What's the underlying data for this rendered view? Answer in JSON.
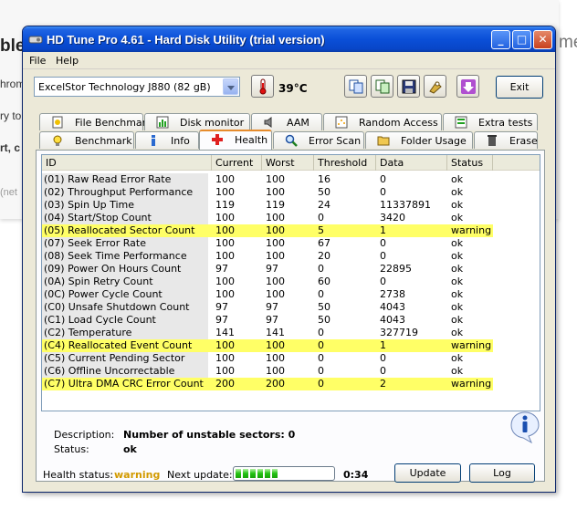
{
  "background_page": {
    "fragments": [
      "ble",
      "hrom",
      "ry to",
      "rt, c",
      "(net",
      "me"
    ]
  },
  "window": {
    "title": "HD Tune Pro 4.61 - Hard Disk Utility (trial version)",
    "minimize_glyph": "_",
    "maximize_glyph": "□",
    "close_glyph": "✕"
  },
  "menu": {
    "file": "File",
    "help": "Help"
  },
  "toolbar": {
    "drive": "ExcelStor Technology J880 (82 gB)",
    "temperature": "39°C",
    "exit_label": "Exit",
    "icons": [
      "copy-icon",
      "copy-alt-icon",
      "save-icon",
      "options-icon",
      "download-icon"
    ]
  },
  "tabs": {
    "top_row": [
      "File Benchmark",
      "Disk monitor",
      "AAM",
      "Random Access",
      "Extra tests"
    ],
    "bottom_row": [
      "Benchmark",
      "Info",
      "Health",
      "Error Scan",
      "Folder Usage",
      "Erase"
    ],
    "active": "Health"
  },
  "table": {
    "columns": [
      "ID",
      "Current",
      "Worst",
      "Threshold",
      "Data",
      "Status"
    ],
    "rows": [
      {
        "id": "(01) Raw Read Error Rate",
        "current": "100",
        "worst": "100",
        "threshold": "16",
        "data": "0",
        "status": "ok",
        "warn": false
      },
      {
        "id": "(02) Throughput Performance",
        "current": "100",
        "worst": "100",
        "threshold": "50",
        "data": "0",
        "status": "ok",
        "warn": false
      },
      {
        "id": "(03) Spin Up Time",
        "current": "119",
        "worst": "119",
        "threshold": "24",
        "data": "11337891",
        "status": "ok",
        "warn": false
      },
      {
        "id": "(04) Start/Stop Count",
        "current": "100",
        "worst": "100",
        "threshold": "0",
        "data": "3420",
        "status": "ok",
        "warn": false
      },
      {
        "id": "(05) Reallocated Sector Count",
        "current": "100",
        "worst": "100",
        "threshold": "5",
        "data": "1",
        "status": "warning",
        "warn": true
      },
      {
        "id": "(07) Seek Error Rate",
        "current": "100",
        "worst": "100",
        "threshold": "67",
        "data": "0",
        "status": "ok",
        "warn": false
      },
      {
        "id": "(08) Seek Time Performance",
        "current": "100",
        "worst": "100",
        "threshold": "20",
        "data": "0",
        "status": "ok",
        "warn": false
      },
      {
        "id": "(09) Power On Hours Count",
        "current": "97",
        "worst": "97",
        "threshold": "0",
        "data": "22895",
        "status": "ok",
        "warn": false
      },
      {
        "id": "(0A) Spin Retry Count",
        "current": "100",
        "worst": "100",
        "threshold": "60",
        "data": "0",
        "status": "ok",
        "warn": false
      },
      {
        "id": "(0C) Power Cycle Count",
        "current": "100",
        "worst": "100",
        "threshold": "0",
        "data": "2738",
        "status": "ok",
        "warn": false
      },
      {
        "id": "(C0) Unsafe Shutdown Count",
        "current": "97",
        "worst": "97",
        "threshold": "50",
        "data": "4043",
        "status": "ok",
        "warn": false
      },
      {
        "id": "(C1) Load Cycle Count",
        "current": "97",
        "worst": "97",
        "threshold": "50",
        "data": "4043",
        "status": "ok",
        "warn": false
      },
      {
        "id": "(C2) Temperature",
        "current": "141",
        "worst": "141",
        "threshold": "0",
        "data": "327719",
        "status": "ok",
        "warn": false
      },
      {
        "id": "(C4) Reallocated Event Count",
        "current": "100",
        "worst": "100",
        "threshold": "0",
        "data": "1",
        "status": "warning",
        "warn": true
      },
      {
        "id": "(C5) Current Pending Sector",
        "current": "100",
        "worst": "100",
        "threshold": "0",
        "data": "0",
        "status": "ok",
        "warn": false
      },
      {
        "id": "(C6) Offline Uncorrectable",
        "current": "100",
        "worst": "100",
        "threshold": "0",
        "data": "0",
        "status": "ok",
        "warn": false
      },
      {
        "id": "(C7) Ultra DMA CRC Error Count",
        "current": "200",
        "worst": "200",
        "threshold": "0",
        "data": "2",
        "status": "warning",
        "warn": true
      }
    ]
  },
  "details": {
    "description_label": "Description:",
    "description_value": "Number of unstable sectors: 0",
    "status_label": "Status:",
    "status_value": "ok"
  },
  "footer": {
    "health_label": "Health status:",
    "health_value": "warning",
    "next_update_label": "Next update:",
    "progress_segments": 6,
    "countdown": "0:34",
    "update_label": "Update",
    "log_label": "Log"
  },
  "colors": {
    "warning_row": "#ffff66",
    "warning_text": "#d29a00",
    "titlebar": "#0a4fd8"
  }
}
